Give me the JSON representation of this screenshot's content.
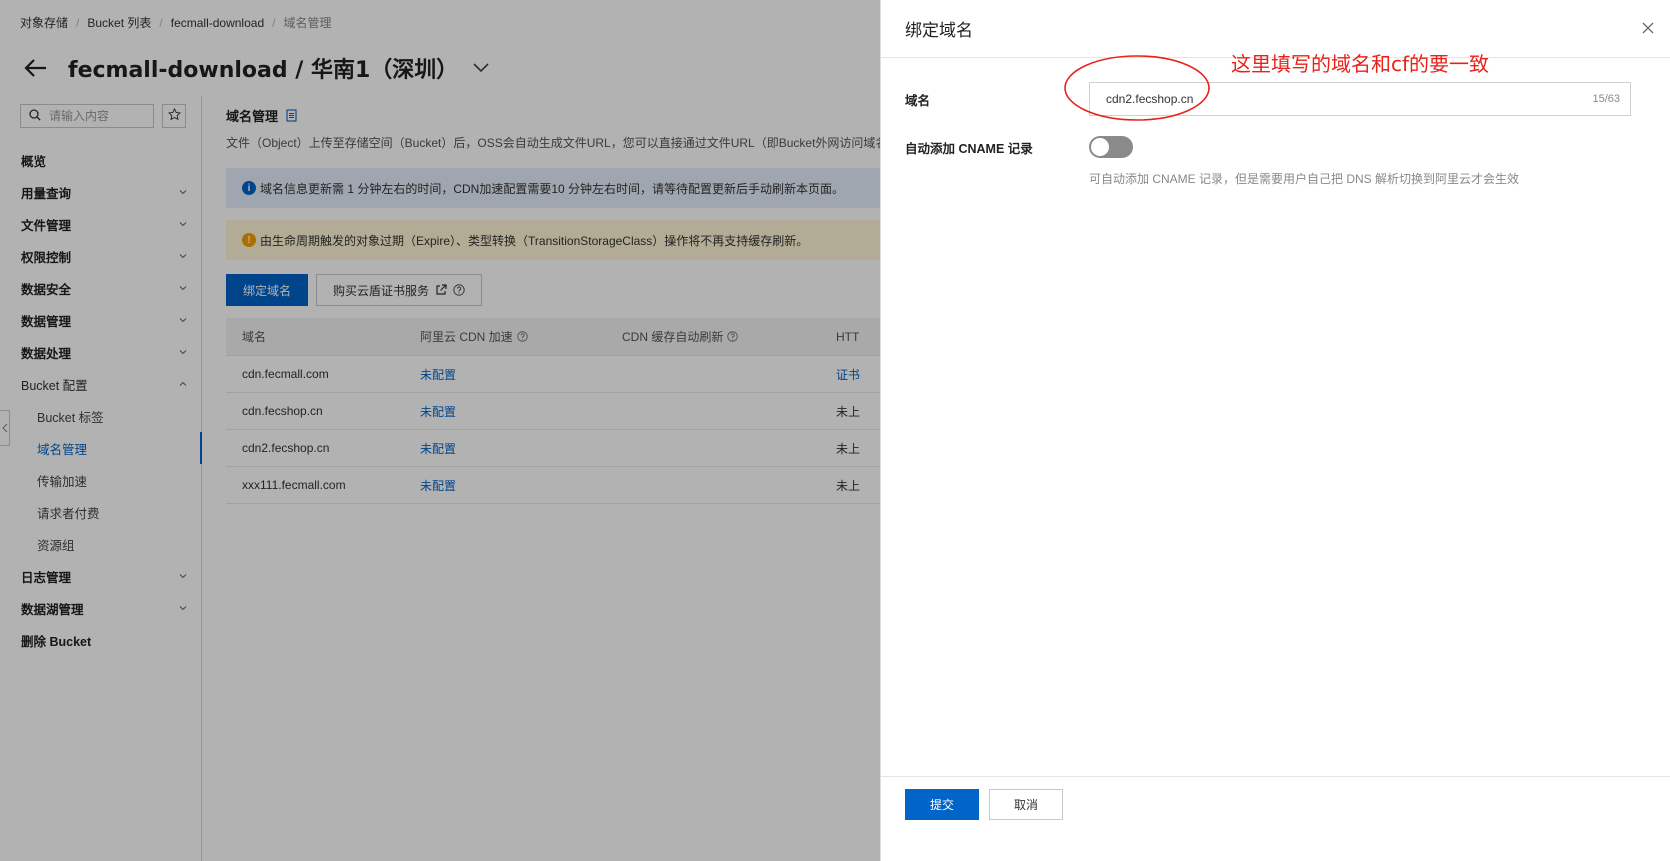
{
  "breadcrumb": {
    "items": [
      "对象存储",
      "Bucket 列表",
      "fecmall-download"
    ],
    "current": "域名管理"
  },
  "header": {
    "title": "fecmall-download / 华南1（深圳）"
  },
  "sidebar": {
    "search_placeholder": "请输入内容",
    "items": [
      {
        "label": "概览"
      },
      {
        "label": "用量查询"
      },
      {
        "label": "文件管理"
      },
      {
        "label": "权限控制"
      },
      {
        "label": "数据安全"
      },
      {
        "label": "数据管理"
      },
      {
        "label": "数据处理"
      },
      {
        "label": "Bucket 配置"
      },
      {
        "label": "Bucket 标签"
      },
      {
        "label": "域名管理"
      },
      {
        "label": "传输加速"
      },
      {
        "label": "请求者付费"
      },
      {
        "label": "资源组"
      },
      {
        "label": "日志管理"
      },
      {
        "label": "数据湖管理"
      },
      {
        "label": "删除 Bucket"
      }
    ]
  },
  "main": {
    "section_title": "域名管理",
    "description": "文件（Object）上传至存储空间（Bucket）后，OSS会自动生成文件URL，您可以直接通过文件URL（即Bucket外网访问域名）访问",
    "info_text": "域名信息更新需 1 分钟左右的时间，CDN加速配置需要10 分钟左右时间，请等待配置更新后手动刷新本页面。",
    "warn_text": "由生命周期触发的对象过期（Expire）、类型转换（TransitionStorageClass）操作将不再支持缓存刷新。",
    "bind_button": "绑定域名",
    "buy_cert_button": "购买云盾证书服务",
    "table": {
      "headers": [
        "域名",
        "阿里云 CDN 加速",
        "CDN 缓存自动刷新",
        "HTT"
      ],
      "rows": [
        {
          "domain": "cdn.fecmall.com",
          "cdn": "未配置",
          "https": "证书"
        },
        {
          "domain": "cdn.fecshop.cn",
          "cdn": "未配置",
          "https": "未上"
        },
        {
          "domain": "cdn2.fecshop.cn",
          "cdn": "未配置",
          "https": "未上"
        },
        {
          "domain": "xxx111.fecmall.com",
          "cdn": "未配置",
          "https": "未上"
        }
      ]
    }
  },
  "drawer": {
    "title": "绑定域名",
    "annotation": "这里填写的域名和cf的要一致",
    "domain_label": "域名",
    "domain_value": "cdn2.fecshop.cn",
    "domain_counter": "15/63",
    "cname_label": "自动添加 CNAME 记录",
    "cname_enabled": false,
    "cname_help": "可自动添加 CNAME 记录，但是需要用户自己把 DNS 解析切换到阿里云才会生效",
    "submit_label": "提交",
    "cancel_label": "取消"
  },
  "colors": {
    "primary": "#0064c8",
    "annotation": "#e8231a",
    "info_bg": "#e5eefb",
    "warn_bg": "#fff5d6"
  }
}
